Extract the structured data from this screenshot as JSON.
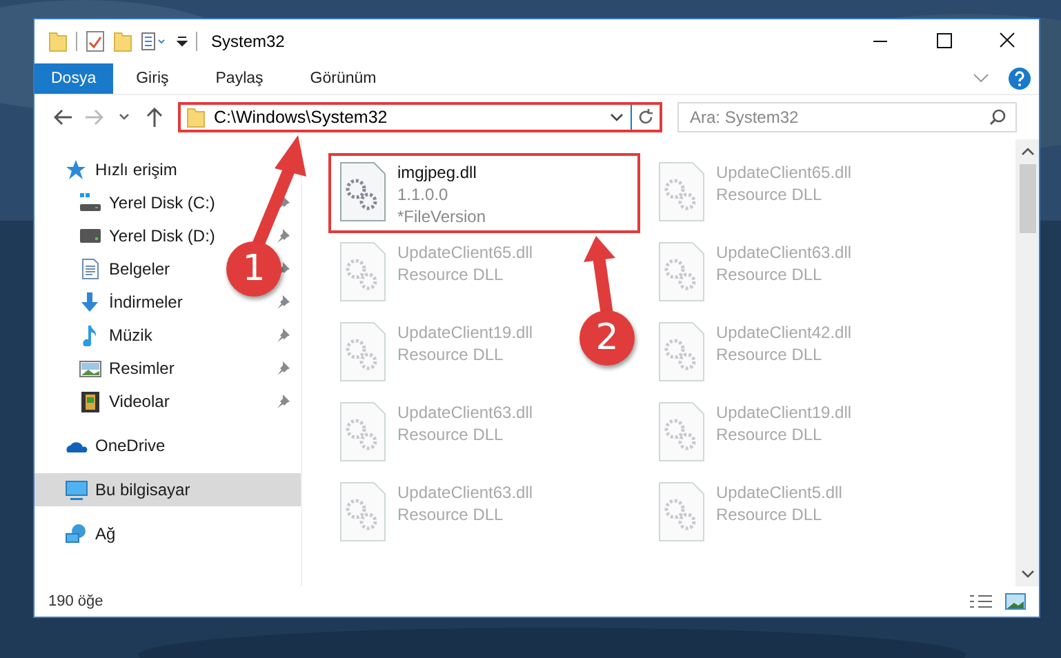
{
  "window": {
    "title": "System32"
  },
  "ribbon_tabs": [
    {
      "label": "Dosya",
      "kind": "file"
    },
    {
      "label": "Giriş",
      "kind": "tab"
    },
    {
      "label": "Paylaş",
      "kind": "tab"
    },
    {
      "label": "Görünüm",
      "kind": "tab"
    }
  ],
  "address": {
    "path": "C:\\Windows\\System32",
    "highlighted": true
  },
  "search": {
    "placeholder": "Ara: System32"
  },
  "sidebar": {
    "items": [
      {
        "label": "Hızlı erişim",
        "kind": "quick-access",
        "selected": false,
        "children": [
          {
            "label": "Yerel Disk (C:)",
            "kind": "system-drive",
            "pinned": true,
            "selected": false
          },
          {
            "label": "Yerel Disk (D:)",
            "kind": "drive",
            "pinned": true,
            "selected": false
          },
          {
            "label": "Belgeler",
            "kind": "documents",
            "pinned": true,
            "selected": false
          },
          {
            "label": "İndirmeler",
            "kind": "downloads",
            "pinned": true,
            "selected": false
          },
          {
            "label": "Müzik",
            "kind": "music",
            "pinned": true,
            "selected": false
          },
          {
            "label": "Resimler",
            "kind": "pictures",
            "pinned": true,
            "selected": false
          },
          {
            "label": "Videolar",
            "kind": "videos",
            "pinned": true,
            "selected": false
          }
        ]
      },
      {
        "label": "OneDrive",
        "kind": "onedrive",
        "selected": false
      },
      {
        "label": "Bu bilgisayar",
        "kind": "computer",
        "selected": true
      },
      {
        "label": "Ağ",
        "kind": "network",
        "selected": false
      }
    ]
  },
  "files": [
    {
      "name": "imgjpeg.dll",
      "details": [
        "1.1.0.0",
        "*FileVersion"
      ],
      "highlighted": true,
      "blurred": false
    },
    {
      "name": "UpdateClient65.dll",
      "details": [
        "Resource DLL"
      ],
      "highlighted": false,
      "blurred": true
    },
    {
      "name": "UpdateClient65.dll",
      "details": [
        "Resource DLL"
      ],
      "highlighted": false,
      "blurred": true
    },
    {
      "name": "UpdateClient63.dll",
      "details": [
        "Resource DLL"
      ],
      "highlighted": false,
      "blurred": true
    },
    {
      "name": "UpdateClient19.dll",
      "details": [
        "Resource DLL"
      ],
      "highlighted": false,
      "blurred": true
    },
    {
      "name": "UpdateClient42.dll",
      "details": [
        "Resource DLL"
      ],
      "highlighted": false,
      "blurred": true
    },
    {
      "name": "UpdateClient63.dll",
      "details": [
        "Resource DLL"
      ],
      "highlighted": false,
      "blurred": true
    },
    {
      "name": "UpdateClient19.dll",
      "details": [
        "Resource DLL"
      ],
      "highlighted": false,
      "blurred": true
    },
    {
      "name": "UpdateClient63.dll",
      "details": [
        "Resource DLL"
      ],
      "highlighted": false,
      "blurred": true
    },
    {
      "name": "UpdateClient5.dll",
      "details": [
        "Resource DLL"
      ],
      "highlighted": false,
      "blurred": true
    }
  ],
  "status_bar": {
    "count": "190 öğe"
  },
  "annotations": [
    {
      "label": "1"
    },
    {
      "label": "2"
    }
  ]
}
